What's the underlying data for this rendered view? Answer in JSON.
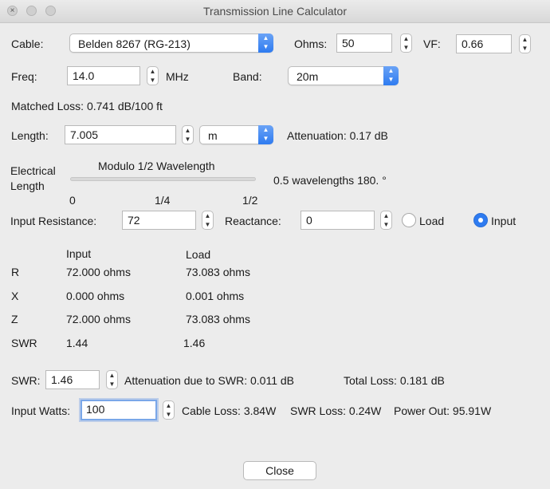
{
  "window": {
    "title": "Transmission Line Calculator"
  },
  "cable": {
    "label": "Cable:",
    "value": "Belden 8267 (RG-213)"
  },
  "ohms": {
    "label": "Ohms:",
    "value": "50"
  },
  "vf": {
    "label": "VF:",
    "value": "0.66"
  },
  "freq": {
    "label": "Freq:",
    "value": "14.0",
    "unit": "MHz"
  },
  "band": {
    "label": "Band:",
    "value": "20m"
  },
  "matched_loss": "Matched Loss: 0.741 dB/100 ft",
  "length": {
    "label": "Length:",
    "value": "7.005",
    "unit": "m"
  },
  "attenuation": "Attenuation: 0.17 dB",
  "electrical_length": {
    "label_line1": "Electrical",
    "label_line2": "Length",
    "slider_title": "Modulo 1/2 Wavelength",
    "slider_position": 1.0,
    "readout": "0.5 wavelengths  180. °",
    "ticks": [
      "0",
      "1/4",
      "1/2"
    ]
  },
  "input_resistance": {
    "label": "Input Resistance:",
    "value": "72"
  },
  "reactance": {
    "label": "Reactance:",
    "value": "0"
  },
  "reference": {
    "load_label": "Load",
    "input_label": "Input",
    "selected": "Input"
  },
  "results": {
    "col_input": "Input",
    "col_load": "Load",
    "rows": [
      {
        "name": "R",
        "input": "72.000 ohms",
        "load": "73.083 ohms"
      },
      {
        "name": "X",
        "input": "0.000 ohms",
        "load": "0.001 ohms"
      },
      {
        "name": "Z",
        "input": "72.000 ohms",
        "load": "73.083 ohms"
      },
      {
        "name": "SWR",
        "input": "1.44",
        "load": "1.46"
      }
    ]
  },
  "swr": {
    "label": "SWR:",
    "value": "1.46",
    "attenuation_due": "Attenuation due to SWR: 0.011 dB",
    "total_loss": "Total Loss: 0.181 dB"
  },
  "input_watts": {
    "label": "Input Watts:",
    "value": "100",
    "cable_loss": "Cable Loss: 3.84W",
    "swr_loss": "SWR Loss: 0.24W",
    "power_out": "Power Out: 95.91W"
  },
  "close_button": "Close",
  "colors": {
    "accent": "#2e7bf0",
    "window_bg": "#ececec",
    "focus_ring": "#7aa7e8"
  }
}
